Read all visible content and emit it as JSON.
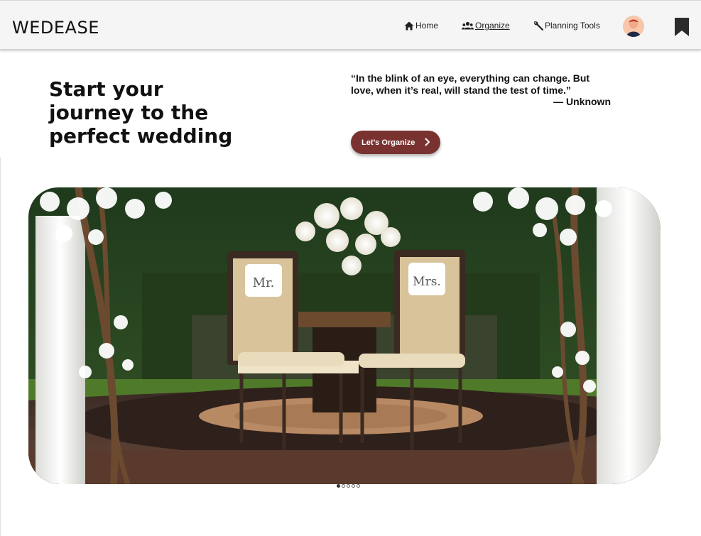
{
  "brand": "WEDEASE",
  "nav": {
    "home": {
      "label": "Home",
      "icon": "home-icon"
    },
    "organize": {
      "label": "Organize",
      "icon": "people-icon"
    },
    "tools": {
      "label": "Planning Tools",
      "icon": "wrench-icon"
    }
  },
  "hero": {
    "headline": "Start your journey to the perfect wedding",
    "quote": "“In the blink of an eye, everything can change. But love, when it’s real, will stand the test of time.”",
    "author": "— Unknown",
    "cta_label": "Let’s Organize"
  },
  "carousel": {
    "slides": 5,
    "active": 0
  },
  "colors": {
    "accent": "#7a3230",
    "nav_bg": "#f5f5f5"
  }
}
